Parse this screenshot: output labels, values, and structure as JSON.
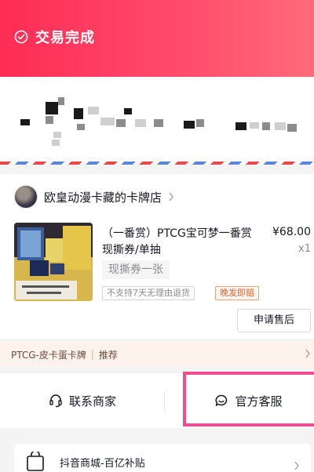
{
  "header": {
    "status_title": "交易完成",
    "background_color": "#fe2c55",
    "icon": "check-circle-icon"
  },
  "shop": {
    "name": "欧皇动漫卡藏的卡牌店",
    "avatar": "shop-avatar"
  },
  "product": {
    "title": "（一番赏）PTCG宝可梦一番赏现撕券/单抽",
    "price": "¥68.00",
    "quantity": "x1",
    "variant": "现撕券一张",
    "tags": {
      "no_return": "不支持7天无理由退货",
      "late_compensation": "晚发即赔"
    },
    "after_sale_button": "申请售后"
  },
  "recommend": {
    "item": "PTCG-皮卡蛋卡牌",
    "label": "推荐"
  },
  "contact": {
    "merchant_label": "联系商家",
    "official_label": "官方客服",
    "highlight_color": "#ee4e8f"
  },
  "promo": {
    "label": "抖音商城-百亿补贴"
  }
}
